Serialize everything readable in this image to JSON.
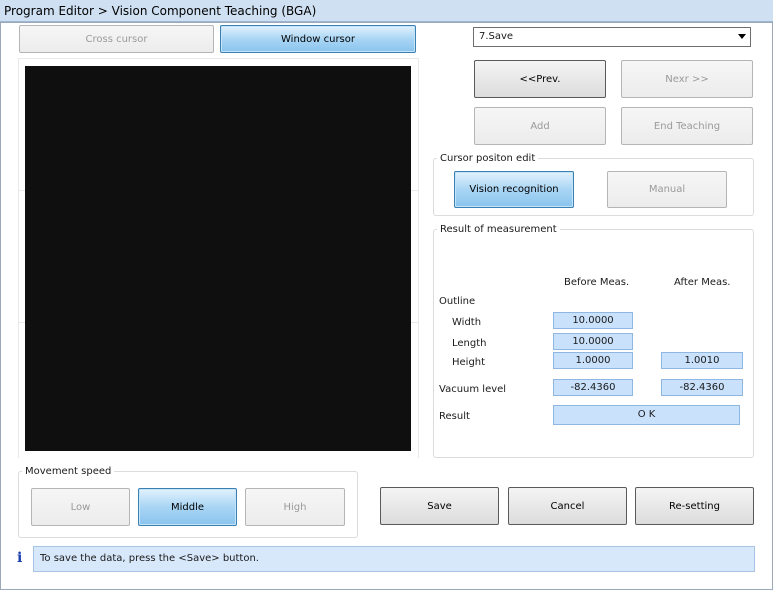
{
  "window": {
    "title": "Program Editor > Vision Component Teaching (BGA)"
  },
  "cursor_mode": {
    "cross": "Cross cursor",
    "window": "Window cursor",
    "selected": "window"
  },
  "step_select": {
    "value": "7.Save"
  },
  "nav": {
    "prev": "<<Prev.",
    "next": "Nexr >>",
    "add": "Add",
    "end": "End Teaching"
  },
  "cursor_edit": {
    "legend": "Cursor positon edit",
    "vision": "Vision recognition",
    "manual": "Manual"
  },
  "measurement": {
    "legend": "Result of measurement",
    "col_before": "Before Meas.",
    "col_after": "After Meas.",
    "outline_label": "Outline",
    "width_label": "Width",
    "length_label": "Length",
    "height_label": "Height",
    "vacuum_label": "Vacuum level",
    "result_label": "Result",
    "width_before": "10.0000",
    "length_before": "10.0000",
    "height_before": "1.0000",
    "height_after": "1.0010",
    "vacuum_before": "-82.4360",
    "vacuum_after": "-82.4360",
    "result_value": "O K"
  },
  "movement": {
    "legend": "Movement speed",
    "low": "Low",
    "middle": "Middle",
    "high": "High",
    "selected": "middle"
  },
  "actions": {
    "save": "Save",
    "cancel": "Cancel",
    "resetting": "Re-setting"
  },
  "status": {
    "message": "To save the data, press the <Save> button."
  },
  "colors": {
    "field_bg": "#c9e1fb",
    "active_button": "#a9d5f4",
    "status_bg": "#d8e8fb",
    "image_bg": "#0f0f0f"
  }
}
